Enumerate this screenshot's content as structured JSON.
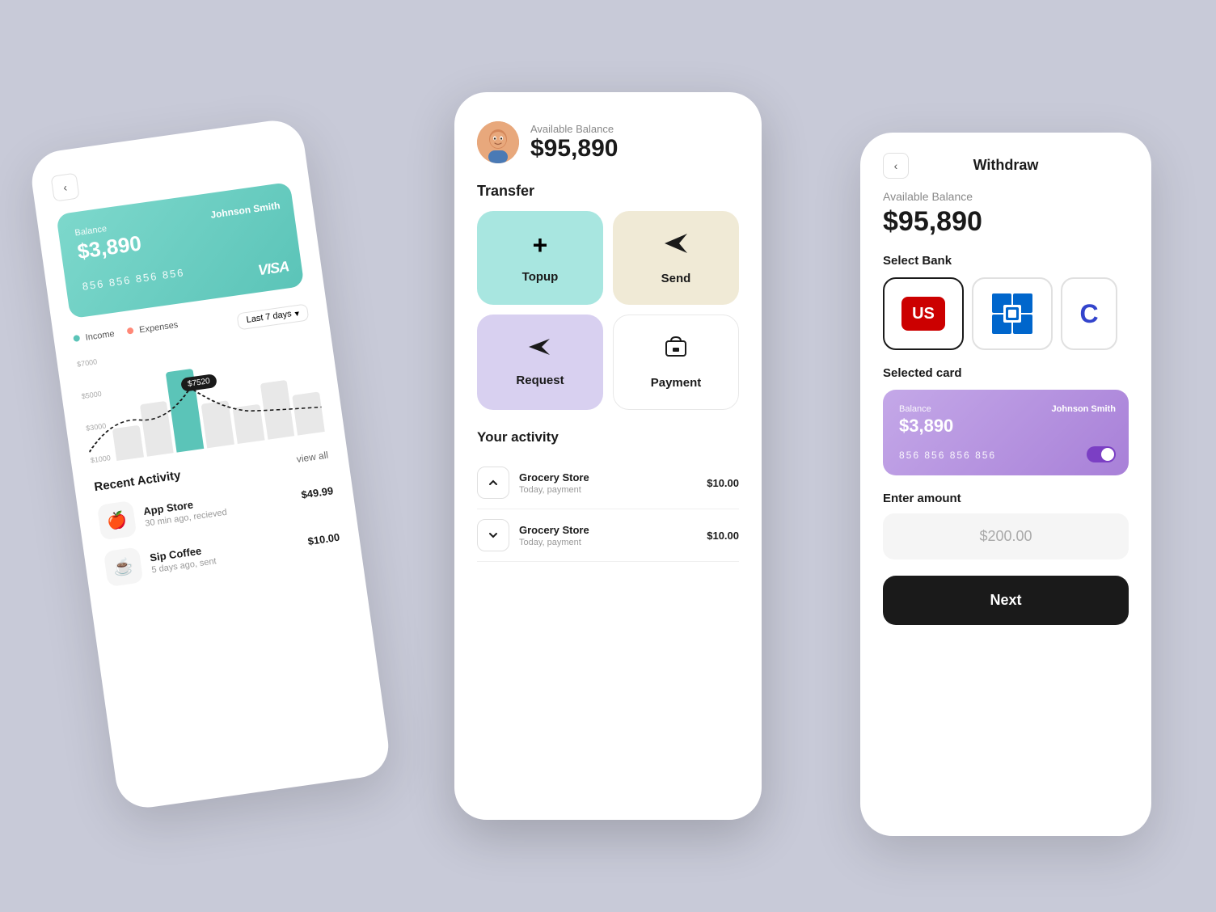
{
  "background_color": "#c8cad8",
  "left_phone": {
    "card": {
      "balance_label": "Balance",
      "balance": "$3,890",
      "holder": "Johnson Smith",
      "number": "856  856  856  856",
      "network": "VISA"
    },
    "chart": {
      "filter_label": "Last 7 days",
      "tooltip": "$7520",
      "legend_income": "Income",
      "legend_expenses": "Expenses",
      "y_labels": [
        "$7000",
        "$5000",
        "$3000",
        "$1000"
      ]
    },
    "recent_activity": {
      "title": "Recent Activity",
      "view_all": "view all",
      "items": [
        {
          "name": "App Store",
          "time": "30 min ago, recieved",
          "amount": "$49.99",
          "icon": "🍎"
        },
        {
          "name": "Sip Coffee",
          "time": "5 days ago, sent",
          "amount": "$10.00",
          "icon": "☕"
        }
      ]
    }
  },
  "middle_phone": {
    "balance_label": "Available Balance",
    "balance": "$95,890",
    "transfer_title": "Transfer",
    "transfer_options": [
      {
        "label": "Topup",
        "icon": "+",
        "style": "teal"
      },
      {
        "label": "Send",
        "icon": "➤",
        "style": "beige"
      },
      {
        "label": "Request",
        "icon": "➤",
        "style": "lavender"
      },
      {
        "label": "Payment",
        "icon": "🛍",
        "style": "white"
      }
    ],
    "activity_title": "Your activity",
    "activities": [
      {
        "name": "Grocery Store",
        "time": "Today, payment",
        "amount": "$10.00"
      },
      {
        "name": "Grocery Store",
        "time": "Today, payment",
        "amount": "$10.00"
      }
    ]
  },
  "right_phone": {
    "title": "Withdraw",
    "available_label": "Available Balance",
    "available_amount": "$95,890",
    "select_bank_label": "Select Bank",
    "banks": [
      {
        "name": "US Bank",
        "selected": true
      },
      {
        "name": "Chase",
        "selected": false
      },
      {
        "name": "Citibank",
        "selected": false
      }
    ],
    "selected_card_label": "Selected card",
    "card": {
      "balance_label": "Balance",
      "balance": "$3,890",
      "holder": "Johnson Smith",
      "number": "856  856  856  856"
    },
    "enter_amount_label": "Enter amount",
    "amount_placeholder": "$200.00",
    "next_button": "Next"
  }
}
